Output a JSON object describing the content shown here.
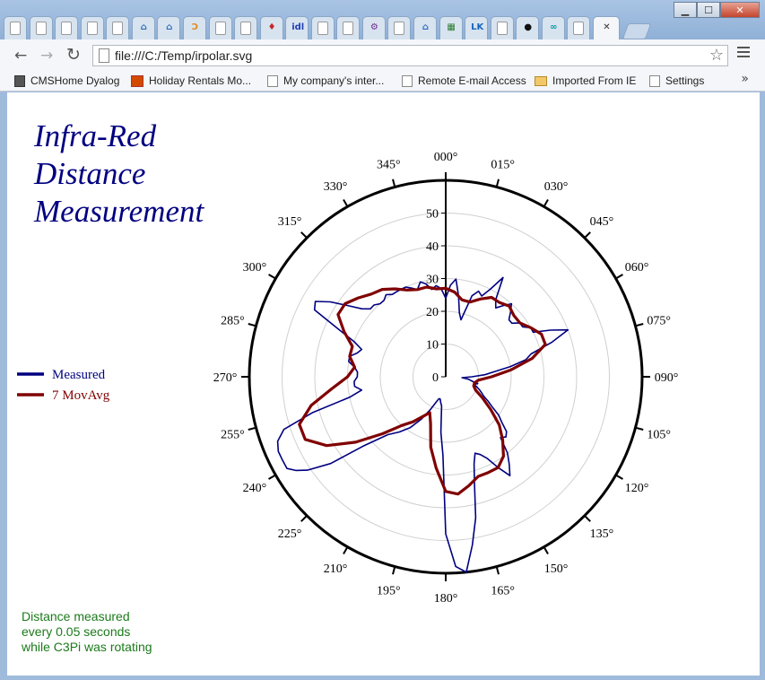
{
  "window": {
    "controls": {
      "minimize": "▁",
      "maximize": "☐",
      "close": "✕"
    }
  },
  "tabs": [
    {
      "icon": "page-icon",
      "glyph": "",
      "color": "#888888"
    },
    {
      "icon": "page-icon",
      "glyph": "",
      "color": "#888888"
    },
    {
      "icon": "page-icon",
      "glyph": "",
      "color": "#888888"
    },
    {
      "icon": "page-icon",
      "glyph": "",
      "color": "#888888"
    },
    {
      "icon": "page-icon",
      "glyph": "",
      "color": "#888888"
    },
    {
      "icon": "github-desktop-icon",
      "glyph": "⌂",
      "color": "#2a6ebb"
    },
    {
      "icon": "github-desktop-icon",
      "glyph": "⌂",
      "color": "#2a6ebb"
    },
    {
      "icon": "curl-icon",
      "glyph": "Ↄ",
      "color": "#e08a1e"
    },
    {
      "icon": "page-icon",
      "glyph": "",
      "color": "#888888"
    },
    {
      "icon": "page-icon",
      "glyph": "",
      "color": "#888888"
    },
    {
      "icon": "puzzle-icon",
      "glyph": "♦",
      "color": "#c62828"
    },
    {
      "icon": "idl-icon",
      "glyph": "idl",
      "color": "#1f3fb5"
    },
    {
      "icon": "page-icon",
      "glyph": "",
      "color": "#888888"
    },
    {
      "icon": "page-icon",
      "glyph": "",
      "color": "#888888"
    },
    {
      "icon": "cyclist-icon",
      "glyph": "⚙",
      "color": "#6a2a8a"
    },
    {
      "icon": "page-icon",
      "glyph": "",
      "color": "#888888"
    },
    {
      "icon": "github-desktop-icon",
      "glyph": "⌂",
      "color": "#2a6ebb"
    },
    {
      "icon": "grid-icon",
      "glyph": "▦",
      "color": "#2e7d32"
    },
    {
      "icon": "latex-icon",
      "glyph": "LK",
      "color": "#1565c0"
    },
    {
      "icon": "page-icon",
      "glyph": "",
      "color": "#888888"
    },
    {
      "icon": "github-icon",
      "glyph": "●",
      "color": "#111111"
    },
    {
      "icon": "arduino-icon",
      "glyph": "∞",
      "color": "#00979c"
    },
    {
      "icon": "page-icon",
      "glyph": "",
      "color": "#888888"
    }
  ],
  "active_tab": {
    "close": "✕"
  },
  "toolbar": {
    "back": "←",
    "forward": "→",
    "reload": "↻",
    "url": "file:///C:/Temp/irpolar.svg",
    "star": "☆"
  },
  "bookmarks": [
    {
      "label": "CMSHome Dyalog",
      "icon": "cms"
    },
    {
      "label": "Holiday Rentals Mo...",
      "icon": "hol"
    },
    {
      "label": "My company's inter...",
      "icon": "page"
    },
    {
      "label": "Remote E-mail Access",
      "icon": "page"
    },
    {
      "label": "Imported From IE",
      "icon": "fold"
    },
    {
      "label": "Settings",
      "icon": "page"
    }
  ],
  "bookmarks_more": "»",
  "chart_data": {
    "type": "polar-line",
    "title": [
      "Infra-Red",
      "Distance",
      "Measurement"
    ],
    "annotation": [
      "Distance measured",
      "every 0.05 seconds",
      "while C3Pi was rotating"
    ],
    "angle_labels": [
      "000°",
      "015°",
      "030°",
      "045°",
      "060°",
      "075°",
      "090°",
      "105°",
      "120°",
      "135°",
      "150°",
      "165°",
      "180°",
      "195°",
      "210°",
      "225°",
      "240°",
      "255°",
      "270°",
      "285°",
      "300°",
      "315°",
      "330°",
      "345°"
    ],
    "radial_ticks": [
      0,
      10,
      20,
      30,
      40,
      50
    ],
    "rlim": [
      0,
      60
    ],
    "grid": true,
    "legend_position": "left",
    "series": [
      {
        "name": "Measured",
        "color": "#000080",
        "points": [
          [
            0,
            24
          ],
          [
            3,
            28
          ],
          [
            6,
            30
          ],
          [
            9,
            25
          ],
          [
            12,
            20
          ],
          [
            15,
            18
          ],
          [
            18,
            26
          ],
          [
            21,
            28
          ],
          [
            24,
            27
          ],
          [
            27,
            30
          ],
          [
            30,
            35
          ],
          [
            33,
            28
          ],
          [
            36,
            26
          ],
          [
            39,
            28
          ],
          [
            42,
            30
          ],
          [
            45,
            28
          ],
          [
            48,
            26
          ],
          [
            51,
            26
          ],
          [
            54,
            28
          ],
          [
            57,
            28
          ],
          [
            60,
            30
          ],
          [
            63,
            30
          ],
          [
            66,
            35
          ],
          [
            69,
            40
          ],
          [
            72,
            34
          ],
          [
            75,
            27
          ],
          [
            78,
            25
          ],
          [
            81,
            20
          ],
          [
            84,
            15
          ],
          [
            87,
            12
          ],
          [
            90,
            8
          ],
          [
            93,
            5
          ],
          [
            96,
            7
          ],
          [
            99,
            8
          ],
          [
            102,
            10
          ],
          [
            105,
            9
          ],
          [
            108,
            10
          ],
          [
            111,
            11
          ],
          [
            114,
            12
          ],
          [
            117,
            13
          ],
          [
            120,
            15
          ],
          [
            123,
            17
          ],
          [
            126,
            20
          ],
          [
            129,
            22
          ],
          [
            132,
            25
          ],
          [
            135,
            26
          ],
          [
            138,
            25
          ],
          [
            141,
            30
          ],
          [
            144,
            33
          ],
          [
            147,
            36
          ],
          [
            150,
            32
          ],
          [
            153,
            28
          ],
          [
            156,
            26
          ],
          [
            159,
            25
          ],
          [
            162,
            28
          ],
          [
            165,
            34
          ],
          [
            168,
            44
          ],
          [
            171,
            52
          ],
          [
            174,
            60
          ],
          [
            177,
            58
          ],
          [
            180,
            48
          ],
          [
            182,
            24
          ],
          [
            185,
            17
          ],
          [
            188,
            9
          ],
          [
            191,
            8
          ],
          [
            194,
            7
          ],
          [
            197,
            7
          ],
          [
            200,
            8
          ],
          [
            205,
            11
          ],
          [
            210,
            15
          ],
          [
            215,
            19
          ],
          [
            220,
            22
          ],
          [
            225,
            25
          ],
          [
            230,
            33
          ],
          [
            233,
            44
          ],
          [
            236,
            51
          ],
          [
            238,
            54
          ],
          [
            240,
            56
          ],
          [
            243,
            56
          ],
          [
            246,
            56
          ],
          [
            249,
            55
          ],
          [
            252,
            52
          ],
          [
            255,
            42
          ],
          [
            258,
            30
          ],
          [
            261,
            26
          ],
          [
            264,
            28
          ],
          [
            267,
            28
          ],
          [
            270,
            27
          ],
          [
            273,
            27
          ],
          [
            276,
            28
          ],
          [
            279,
            30
          ],
          [
            282,
            30
          ],
          [
            285,
            28
          ],
          [
            288,
            27
          ],
          [
            291,
            30
          ],
          [
            294,
            36
          ],
          [
            297,
            45
          ],
          [
            300,
            46
          ],
          [
            303,
            42
          ],
          [
            306,
            37
          ],
          [
            309,
            33
          ],
          [
            312,
            31
          ],
          [
            315,
            31
          ],
          [
            318,
            30
          ],
          [
            321,
            30
          ],
          [
            324,
            31
          ],
          [
            327,
            30
          ],
          [
            330,
            30
          ],
          [
            333,
            30
          ],
          [
            336,
            30
          ],
          [
            339,
            29
          ],
          [
            342,
            28
          ],
          [
            345,
            30
          ],
          [
            348,
            29
          ],
          [
            351,
            27
          ],
          [
            354,
            28
          ],
          [
            357,
            27
          ],
          [
            360,
            24
          ]
        ]
      },
      {
        "name": "7 MovAvg",
        "color": "#800000",
        "points": [
          [
            0,
            27
          ],
          [
            6,
            26
          ],
          [
            12,
            24
          ],
          [
            18,
            24
          ],
          [
            24,
            26
          ],
          [
            30,
            28
          ],
          [
            36,
            28
          ],
          [
            42,
            29
          ],
          [
            48,
            28
          ],
          [
            54,
            28
          ],
          [
            60,
            30
          ],
          [
            66,
            32
          ],
          [
            72,
            32
          ],
          [
            78,
            27
          ],
          [
            84,
            20
          ],
          [
            90,
            14
          ],
          [
            96,
            10
          ],
          [
            102,
            9
          ],
          [
            108,
            9
          ],
          [
            114,
            10
          ],
          [
            120,
            13
          ],
          [
            126,
            17
          ],
          [
            132,
            22
          ],
          [
            138,
            26
          ],
          [
            144,
            30
          ],
          [
            150,
            32
          ],
          [
            156,
            32
          ],
          [
            162,
            32
          ],
          [
            168,
            34
          ],
          [
            174,
            36
          ],
          [
            180,
            35
          ],
          [
            186,
            28
          ],
          [
            192,
            22
          ],
          [
            198,
            15
          ],
          [
            204,
            12
          ],
          [
            210,
            14
          ],
          [
            216,
            17
          ],
          [
            222,
            20
          ],
          [
            228,
            26
          ],
          [
            234,
            34
          ],
          [
            240,
            42
          ],
          [
            246,
            47
          ],
          [
            252,
            47
          ],
          [
            258,
            42
          ],
          [
            264,
            35
          ],
          [
            270,
            30
          ],
          [
            276,
            28
          ],
          [
            282,
            30
          ],
          [
            288,
            30
          ],
          [
            294,
            34
          ],
          [
            300,
            38
          ],
          [
            306,
            38
          ],
          [
            312,
            36
          ],
          [
            318,
            34
          ],
          [
            324,
            33
          ],
          [
            330,
            31
          ],
          [
            336,
            29
          ],
          [
            342,
            28
          ],
          [
            348,
            28
          ],
          [
            354,
            27
          ],
          [
            360,
            27
          ]
        ]
      }
    ]
  }
}
